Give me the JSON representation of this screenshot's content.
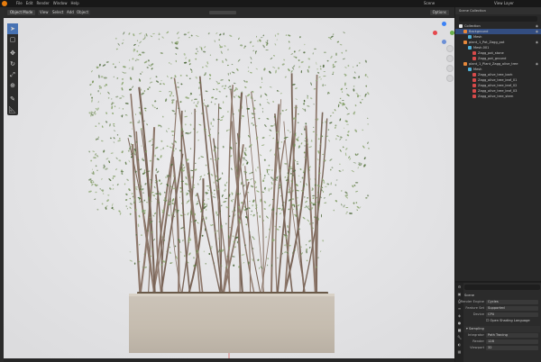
{
  "topbar": {
    "menus": [
      "File",
      "Edit",
      "Render",
      "Window",
      "Help"
    ],
    "scene": "Scene",
    "view_layer": "View Layer"
  },
  "viewport": {
    "mode": "Object Mode",
    "menus": [
      "View",
      "Select",
      "Add",
      "Object"
    ],
    "options_label": "Options",
    "overlay_lines": [
      "User Perspective",
      "(1) Scene Collection | ..."
    ]
  },
  "tools": [
    "cursor-icon",
    "select-box-icon",
    "move-icon",
    "rotate-icon",
    "scale-icon",
    "transform-icon",
    "annotate-icon",
    "measure-icon"
  ],
  "outliner": {
    "title": "Scene Collection",
    "search_placeholder": "",
    "rows": [
      {
        "label": "Collection",
        "indent": 0,
        "icon": "collection",
        "selected": false
      },
      {
        "label": "Background",
        "indent": 1,
        "icon": "object",
        "selected": true
      },
      {
        "label": "Mesh",
        "indent": 2,
        "icon": "mesh",
        "selected": false
      },
      {
        "label": "plant_1_Pot_Zagg_pot",
        "indent": 1,
        "icon": "object",
        "selected": false
      },
      {
        "label": "Mesh.001",
        "indent": 2,
        "icon": "mesh",
        "selected": false
      },
      {
        "label": "Zagg_pot_stone",
        "indent": 3,
        "icon": "material",
        "selected": false
      },
      {
        "label": "Zagg_pot_ground",
        "indent": 3,
        "icon": "material",
        "selected": false
      },
      {
        "label": "plant_1_Plant_Zagg_olive_tree",
        "indent": 1,
        "icon": "object",
        "selected": false
      },
      {
        "label": "Mesh",
        "indent": 2,
        "icon": "mesh",
        "selected": false
      },
      {
        "label": "Zagg_olive_tree_bark",
        "indent": 3,
        "icon": "material",
        "selected": false
      },
      {
        "label": "Zagg_olive_tree_leaf_01",
        "indent": 3,
        "icon": "material",
        "selected": false
      },
      {
        "label": "Zagg_olive_tree_leaf_02",
        "indent": 3,
        "icon": "material",
        "selected": false
      },
      {
        "label": "Zagg_olive_tree_leaf_03",
        "indent": 3,
        "icon": "material",
        "selected": false
      },
      {
        "label": "Zagg_olive_tree_stem",
        "indent": 3,
        "icon": "material",
        "selected": false
      }
    ]
  },
  "properties": {
    "title": "Scene",
    "rows": [
      {
        "label": "Render Engine",
        "value": "Cycles"
      },
      {
        "label": "Feature Set",
        "value": "Supported"
      },
      {
        "label": "Device",
        "value": "CPU"
      }
    ],
    "checkbox": "Open Shading Language",
    "section": "Sampling",
    "sampling_rows": [
      {
        "label": "Integrator",
        "value": "Path Tracing"
      },
      {
        "label": "Render",
        "value": "128"
      },
      {
        "label": "Viewport",
        "value": "32"
      }
    ]
  },
  "colors": {
    "accent": "#4772b3",
    "axis_x": "#e5484d",
    "axis_y": "#6ab04c",
    "axis_z": "#3b82f6"
  }
}
